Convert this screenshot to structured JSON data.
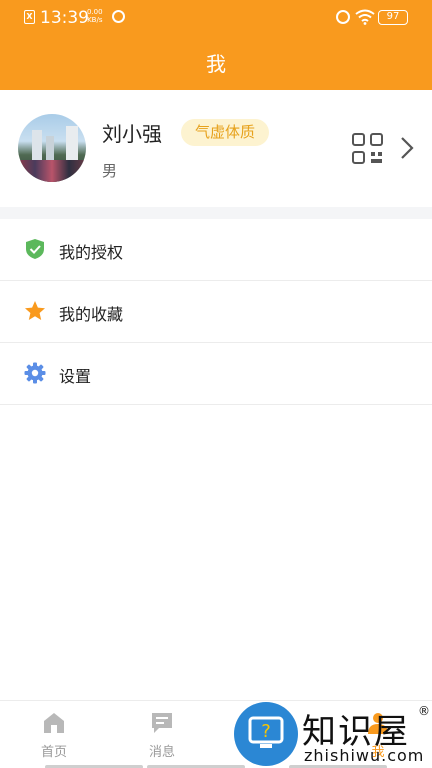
{
  "status_bar": {
    "sim_label": "X",
    "time": "13:39",
    "speed_value": "0.00",
    "speed_unit": "KB/s",
    "battery": "97"
  },
  "header": {
    "title": "我"
  },
  "profile": {
    "name": "刘小强",
    "constitution_badge": "气虚体质",
    "gender": "男"
  },
  "menu": [
    {
      "label": "我的授权",
      "icon": "shield-check-icon",
      "color": "#5cb85c"
    },
    {
      "label": "我的收藏",
      "icon": "star-icon",
      "color": "#f99a1e"
    },
    {
      "label": "设置",
      "icon": "gear-icon",
      "color": "#5b8ee6"
    }
  ],
  "bottom_nav": [
    {
      "label": "首页",
      "icon": "home-icon"
    },
    {
      "label": "消息",
      "icon": "message-icon"
    },
    {
      "label": "",
      "icon": ""
    },
    {
      "label": "我",
      "icon": "user-icon",
      "active": true
    }
  ],
  "watermark": {
    "text": "知识屋",
    "reg": "®",
    "domain": "zhishiwu.com"
  },
  "colors": {
    "accent": "#f99a1e",
    "badge_bg": "#fdf3d0",
    "badge_text": "#e7a21c"
  }
}
